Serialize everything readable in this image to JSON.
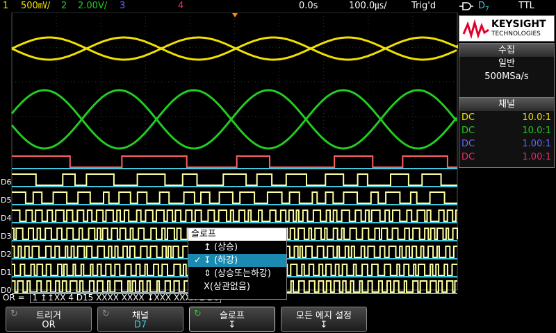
{
  "status": {
    "ch1": {
      "num": "1",
      "scale": "500㎷/",
      "color": "#f0e000"
    },
    "ch2": {
      "num": "2",
      "scale": "2.00V/",
      "color": "#22cc22"
    },
    "ch3": {
      "num": "3",
      "color": "#6666ff"
    },
    "ch4": {
      "num": "4",
      "color": "#e0306a"
    },
    "time_delay": "0.0s",
    "timebase": "100.0㎲/",
    "trig_state": "Trig'd",
    "trig_source": "D",
    "trig_source_sub": "7",
    "logic_threshold": "TTL"
  },
  "brand": {
    "name": "KEYSIGHT",
    "sub": "TECHNOLOGIES"
  },
  "acquisition": {
    "header": "수집",
    "mode": "일반",
    "rate": "500MSa/s"
  },
  "channels_panel": {
    "header": "채널",
    "rows": [
      {
        "coupling": "DC",
        "probe": "10.0:1",
        "color": "#f0e000"
      },
      {
        "coupling": "DC",
        "probe": "10.0:1",
        "color": "#22cc22"
      },
      {
        "coupling": "DC",
        "probe": "1.00:1",
        "color": "#6666ff"
      },
      {
        "coupling": "DC",
        "probe": "1.00:1",
        "color": "#e0306a"
      }
    ]
  },
  "digital_labels": [
    "D6",
    "D5",
    "D4",
    "D3",
    "D2",
    "D1",
    "D0"
  ],
  "trigger_summary": {
    "prefix": "OR =",
    "pattern": "1 ↥↥XX 4 D15 XXXX XXXX ↧XXX XXXX 1 D0"
  },
  "slope_popup": {
    "title": "슬로프",
    "items": [
      {
        "label": "↥ (상승)",
        "selected": false
      },
      {
        "label": "↧ (하강)",
        "selected": true
      },
      {
        "label": "⇕ (상승또는하강)",
        "selected": false
      },
      {
        "label": "X(상관없음)",
        "selected": false
      }
    ],
    "check": "✓"
  },
  "softkeys": [
    {
      "label": "트리거",
      "value": "OR"
    },
    {
      "label": "채널",
      "value": "D7"
    },
    {
      "label": "슬로프",
      "value": "↧"
    },
    {
      "label": "모든 에지 설정",
      "value": "↧"
    }
  ],
  "colors": {
    "ch1": "#f0e000",
    "ch2": "#22cc22",
    "digital_top": "#ff6060",
    "digital": "#ffffa0",
    "digital_base": "#40c8e0",
    "grid": "#3a3a3a"
  }
}
